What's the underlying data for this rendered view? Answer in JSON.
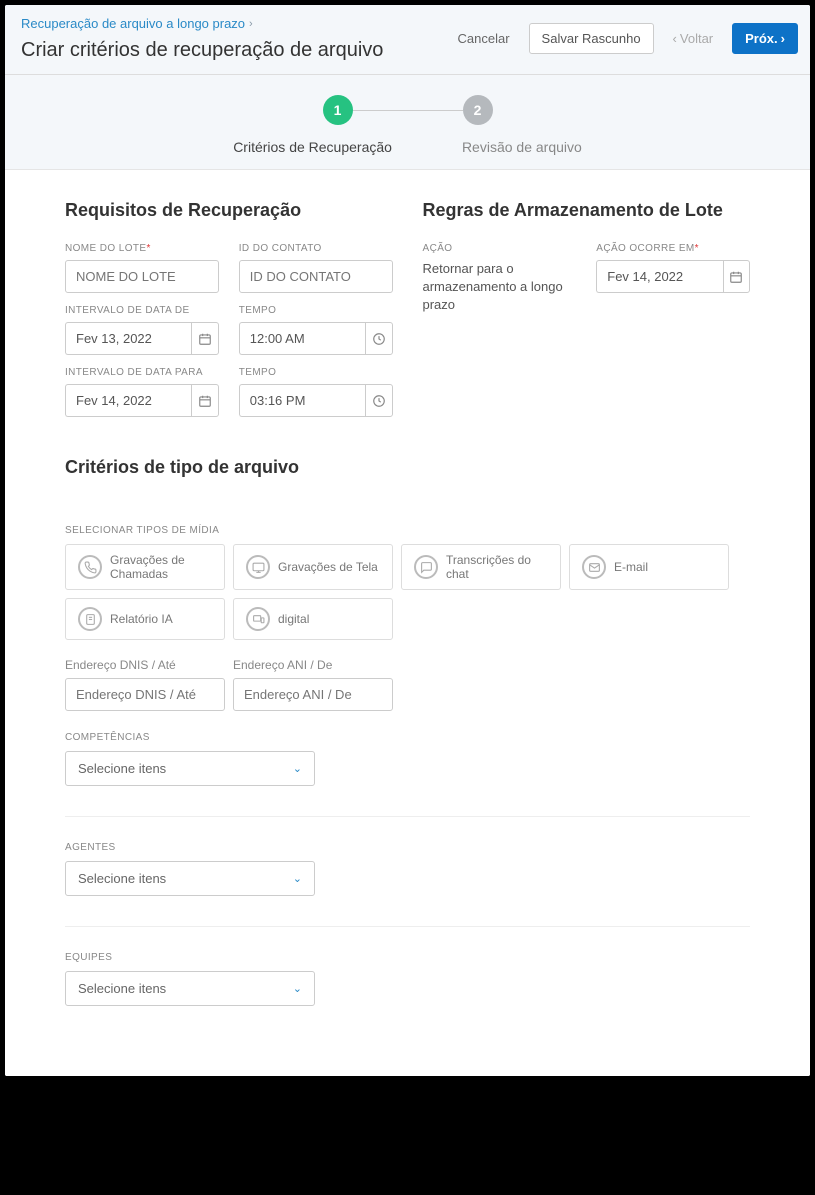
{
  "breadcrumb": {
    "label": "Recuperação de arquivo a longo prazo"
  },
  "title": "Criar critérios de recuperação de arquivo",
  "actions": {
    "cancel": "Cancelar",
    "saveDraft": "Salvar Rascunho",
    "back": "Voltar",
    "next": "Próx."
  },
  "steps": {
    "one": "1",
    "two": "2",
    "label1": "Critérios de Recuperação",
    "label2": "Revisão de arquivo"
  },
  "recovery": {
    "heading": "Requisitos de Recuperação",
    "lotNameLabel": "NOME DO LOTE",
    "lotNamePlaceholder": "NOME DO LOTE",
    "contactIdLabel": "ID DO CONTATO",
    "contactIdPlaceholder": "ID DO CONTATO",
    "dateFromLabel": "INTERVALO DE DATA DE",
    "dateFromValue": "Fev 13, 2022",
    "timeFromLabel": "TEMPO",
    "timeFromValue": "12:00 AM",
    "dateToLabel": "INTERVALO DE DATA PARA",
    "dateToValue": "Fev 14, 2022",
    "timeToLabel": "TEMPO",
    "timeToValue": "03:16 PM"
  },
  "rules": {
    "heading": "Regras de Armazenamento de Lote",
    "actionLabel": "AÇÃO",
    "actionText": "Retornar para o armazenamento a longo prazo",
    "occursLabel": "AÇÃO OCORRE EM",
    "occursValue": "Fev 14, 2022"
  },
  "fileCriteria": {
    "heading": "Critérios de tipo de arquivo",
    "mediaLabel": "SELECIONAR TIPOS DE MÍDIA",
    "media": {
      "callRecordings": "Gravações de Chamadas",
      "screenRecordings": "Gravações de Tela",
      "chatTranscripts": "Transcrições do chat",
      "email": "E-mail",
      "iaReport": "Relatório IA",
      "digital": "digital"
    },
    "dnisLabel": "Endereço DNIS / Até",
    "dnisPlaceholder": "Endereço DNIS / Até",
    "aniLabel": "Endereço ANI / De",
    "aniPlaceholder": "Endereço ANI / De"
  },
  "selectors": {
    "skillsLabel": "COMPETÊNCIAS",
    "agentsLabel": "AGENTES",
    "teamsLabel": "EQUIPES",
    "placeholder": "Selecione itens"
  }
}
